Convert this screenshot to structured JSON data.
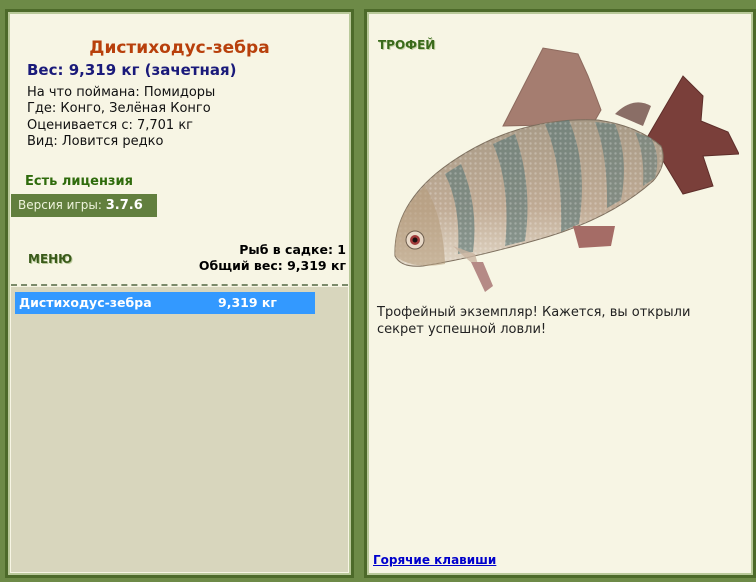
{
  "fish": {
    "name": "Дистиходус-зебра",
    "weight_line": "Вес: 9,319 кг (зачетная)",
    "bait": "На что поймана: Помидоры",
    "where": "Где: Конго, Зелёная Конго",
    "value": "Оценивается с: 7,701 кг",
    "kind": "Вид: Ловится редко"
  },
  "license": "Есть лицензия",
  "version": {
    "label": "Версия игры:",
    "number": "3.7.6"
  },
  "menu_label": "МЕНЮ",
  "keep": {
    "count_line": "Рыб в садке: 1",
    "total_line": "Общий вес: 9,319 кг"
  },
  "catch_list": [
    {
      "name": "Дистиходус-зебра",
      "weight": "9,319 кг"
    }
  ],
  "trophy": {
    "label": "ТРОФЕЙ",
    "message": "Трофейный экземпляр! Кажется, вы открыли секрет успешной ловли!"
  },
  "hotkeys_link": "Горячие клавиши",
  "colors": {
    "background": "#6d8a47",
    "panel": "#f7f5e4",
    "title": "#b8400c",
    "selection": "#3399ff",
    "link": "#0000cc"
  }
}
